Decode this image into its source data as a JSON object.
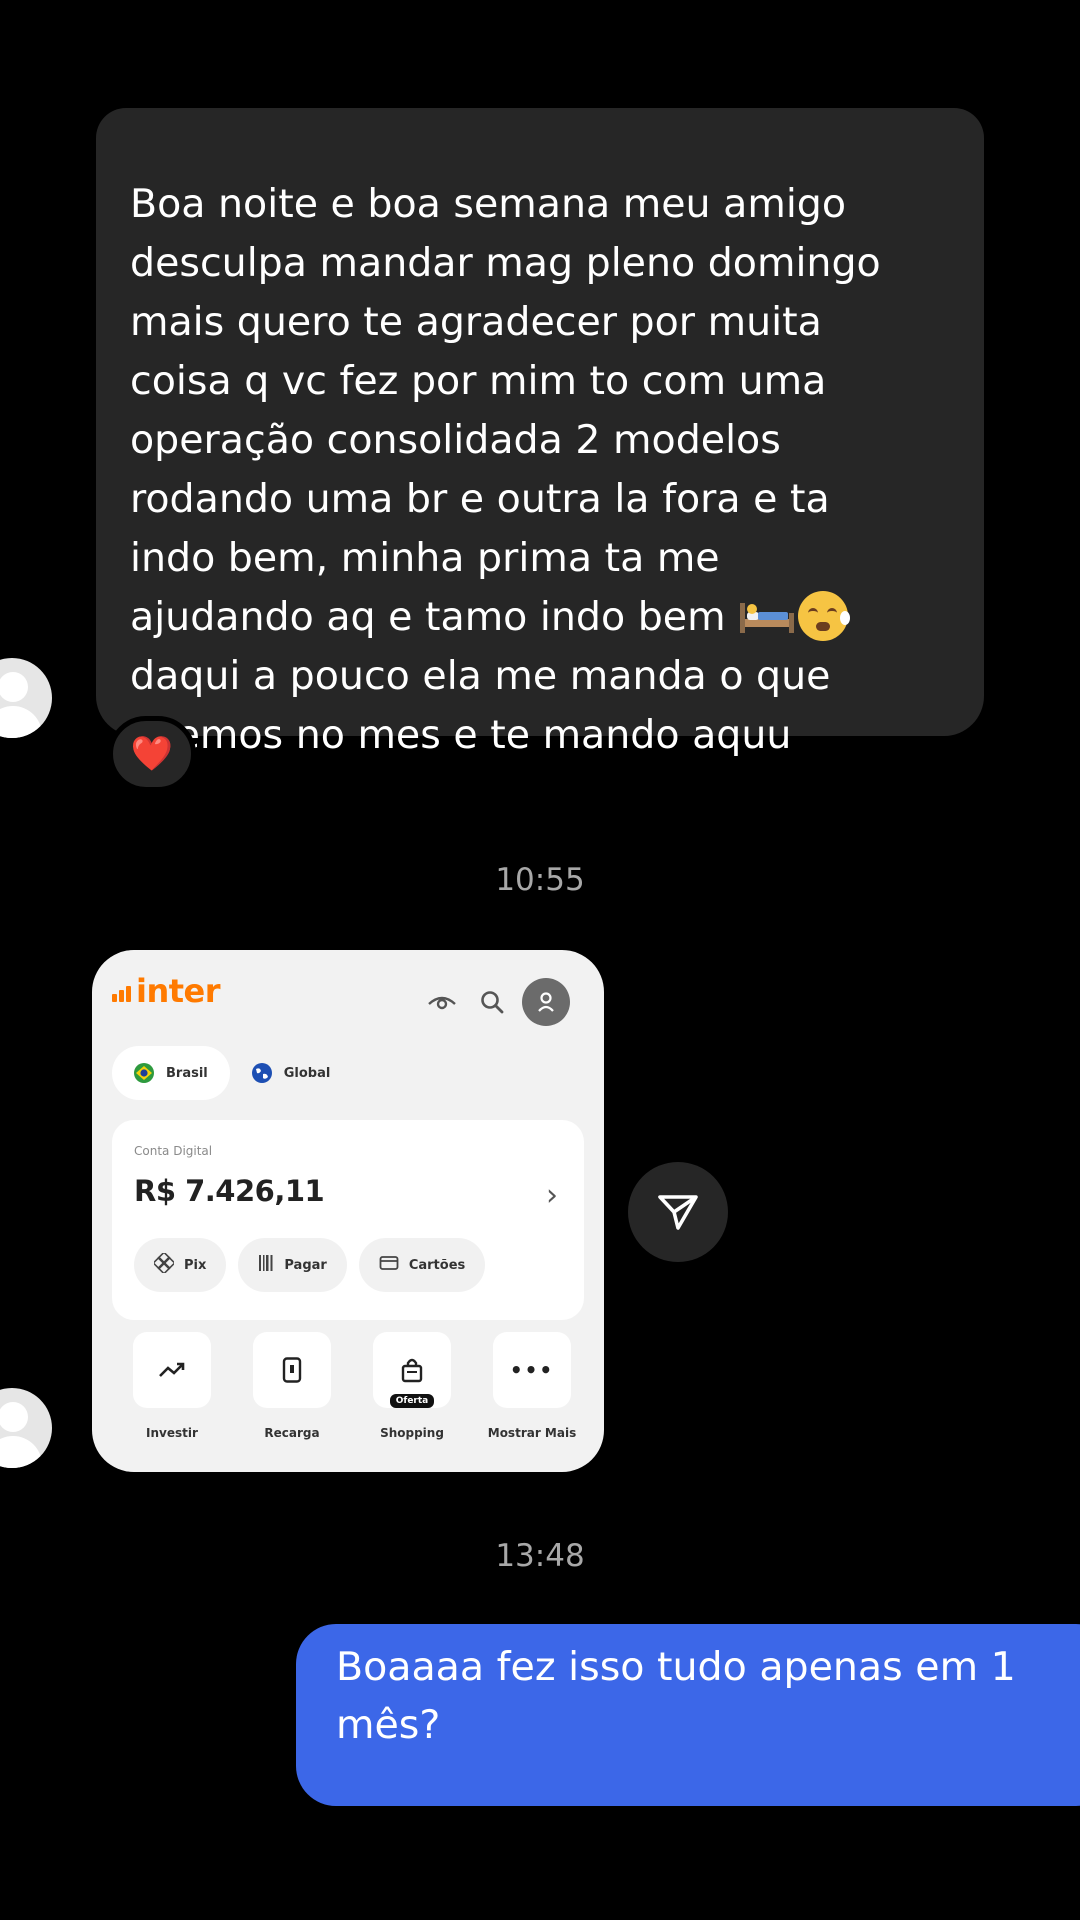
{
  "thread": {
    "incoming_message": {
      "lines": [
        "Boa noite e boa semana meu amigo",
        "desculpa mandar mag pleno domingo",
        "mais quero te agradecer por muita",
        "coisa q vc fez por mim to com uma",
        "operação consolidada 2 modelos",
        "rodando uma br e outra la fora e ta",
        "indo bem, minha prima ta me",
        "ajudando aq e tamo indo bem",
        "daqui a pouco ela me manda o que",
        "fizemos no mes e te mando aquu"
      ],
      "emojis": [
        "bed-emoji",
        "tearful-face-emoji"
      ],
      "reaction": "❤️"
    },
    "timestamp_1": "10:55",
    "shared_screenshot": {
      "brand": "inter",
      "brand_color": "#ff7a00",
      "tabs": [
        {
          "label": "Brasil",
          "active": true
        },
        {
          "label": "Global",
          "active": false
        }
      ],
      "account_label": "Conta Digital",
      "balance": "R$ 7.426,11",
      "actions": [
        {
          "label": "Pix",
          "icon": "pix-icon"
        },
        {
          "label": "Pagar",
          "icon": "barcode-icon"
        },
        {
          "label": "Cartões",
          "icon": "card-icon"
        }
      ],
      "quick_links": [
        {
          "label": "Investir",
          "icon": "trend-up-icon"
        },
        {
          "label": "Recarga",
          "icon": "phone-icon"
        },
        {
          "label": "Shopping",
          "icon": "shopping-bag-icon",
          "badge": "Oferta"
        },
        {
          "label": "Mostrar Mais",
          "icon": "more-icon"
        }
      ]
    },
    "timestamp_2": "13:48",
    "outgoing_message": {
      "lines": [
        "Boaaaa fez isso tudo apenas em 1",
        "mês?"
      ],
      "color": "#3c67e8"
    }
  }
}
